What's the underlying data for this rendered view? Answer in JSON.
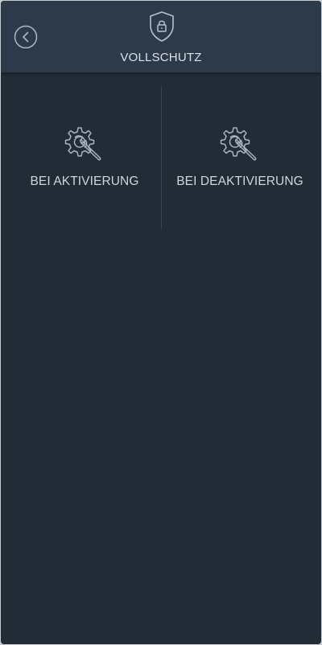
{
  "header": {
    "title": "VOLLSCHUTZ",
    "back_icon": "chevron-left-circle-icon",
    "shield_icon": "shield-lock-icon"
  },
  "options": [
    {
      "label": "BEI AKTIVIERUNG",
      "icon": "gear-wrench-icon"
    },
    {
      "label": "BEI DEAKTIVIERUNG",
      "icon": "gear-wrench-icon"
    }
  ],
  "colors": {
    "background": "#222c37",
    "header": "#2d3a4a",
    "icon_stroke": "#a9b3be",
    "text": "#cfd6de"
  }
}
